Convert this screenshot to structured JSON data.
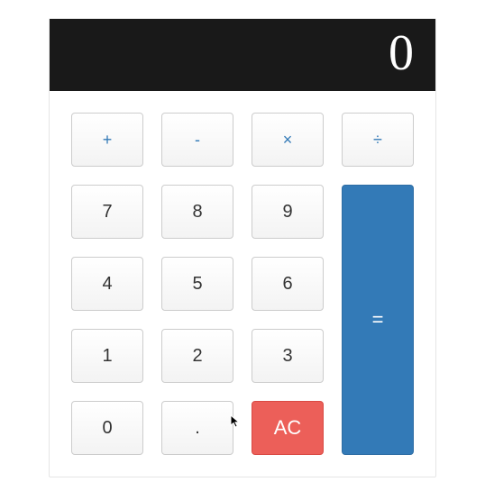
{
  "display": "0",
  "buttons": {
    "add": "+",
    "subtract": "-",
    "multiply": "×",
    "divide": "÷",
    "seven": "7",
    "eight": "8",
    "nine": "9",
    "four": "4",
    "five": "5",
    "six": "6",
    "one": "1",
    "two": "2",
    "three": "3",
    "zero": "0",
    "decimal": ".",
    "clear": "AC",
    "equals": "="
  }
}
